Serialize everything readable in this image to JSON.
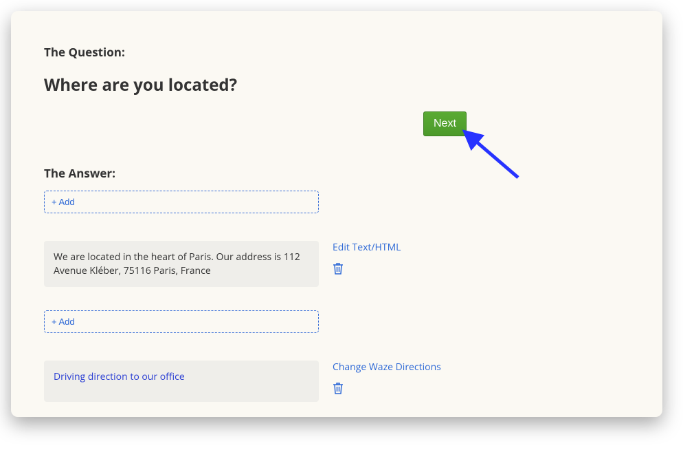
{
  "question": {
    "label": "The Question:",
    "text": "Where are you located?"
  },
  "answer": {
    "label": "The Answer:",
    "add_label": "+ Add",
    "blocks": [
      {
        "type": "text",
        "content": "We are located in the heart of Paris. Our address is 112 Avenue Kléber, 75116 Paris, France",
        "edit_label": "Edit Text/HTML"
      },
      {
        "type": "waze",
        "content": "Driving direction to our office",
        "edit_label": "Change Waze Directions"
      }
    ]
  },
  "next_label": "Next"
}
